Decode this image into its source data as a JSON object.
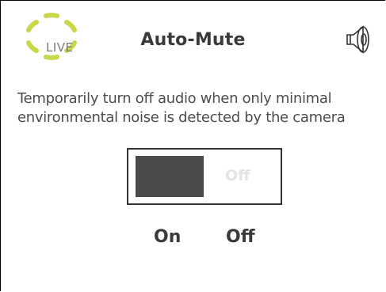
{
  "header": {
    "logo_small_text": "",
    "logo_text": "LIVE",
    "title": "Auto-Mute",
    "speaker_icon": "speaker-icon"
  },
  "description": {
    "line1": "Temporarily turn off audio when only minimal",
    "line2": "environmental noise is detected by the camera"
  },
  "toggle": {
    "state": "On",
    "inner_off_label": "Off",
    "on_label": "On",
    "off_label": "Off"
  },
  "colors": {
    "logo_accent": "#c8d84a",
    "thumb": "#4a4a4a",
    "title": "#3a3a3a"
  }
}
